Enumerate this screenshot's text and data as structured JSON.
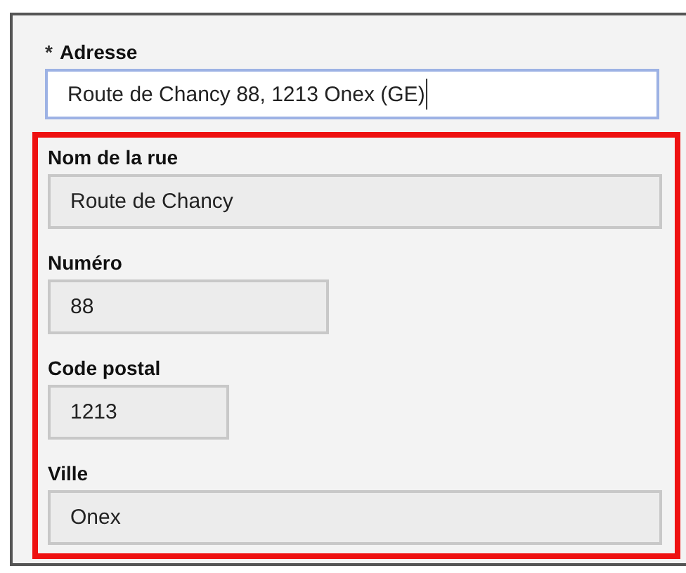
{
  "address": {
    "label": "Adresse",
    "required_mark": "*",
    "value": "Route de Chancy 88, 1213 Onex (GE)",
    "focused": true
  },
  "highlighted": true,
  "fields": [
    {
      "label": "Nom de la rue",
      "value": "Route de Chancy",
      "kind": "long",
      "disabled": true
    },
    {
      "label": "Numéro",
      "value": "88",
      "kind": "medium",
      "disabled": true
    },
    {
      "label": "Code postal",
      "value": "1213",
      "kind": "short",
      "disabled": true
    },
    {
      "label": "Ville",
      "value": "Onex",
      "kind": "long",
      "disabled": true
    }
  ]
}
